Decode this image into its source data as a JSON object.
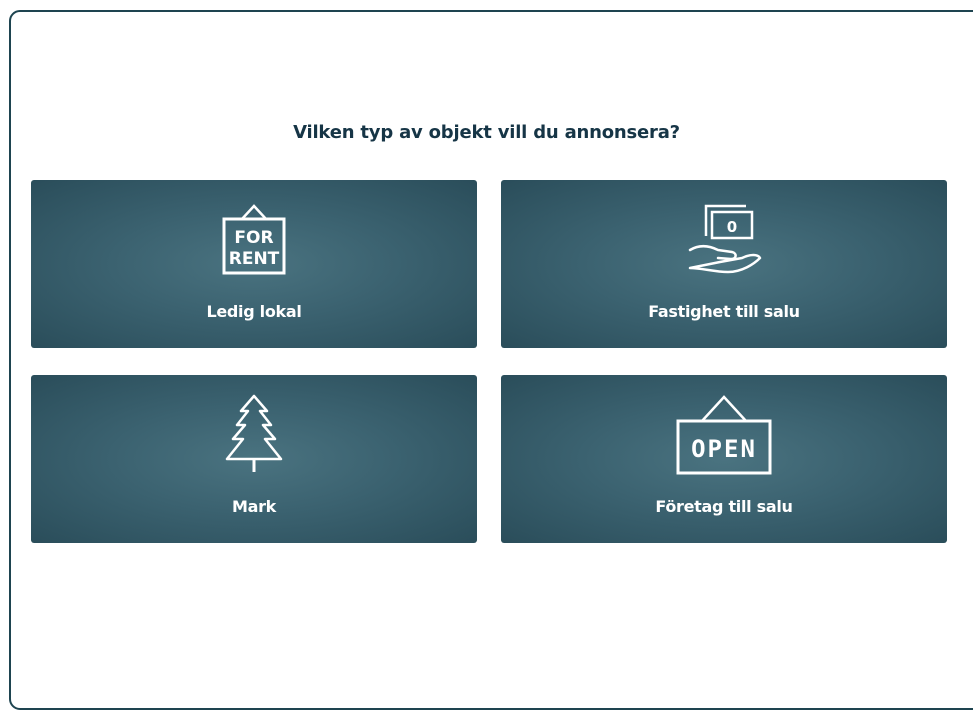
{
  "page": {
    "question": "Vilken typ av objekt vill du annonsera?"
  },
  "cards": [
    {
      "label": "Ledig lokal",
      "icon": "for-rent-sign-icon",
      "icon_text_line1": "FOR",
      "icon_text_line2": "RENT"
    },
    {
      "label": "Fastighet till salu",
      "icon": "money-in-hand-icon",
      "icon_text": "0"
    },
    {
      "label": "Mark",
      "icon": "tree-icon"
    },
    {
      "label": "Företag till salu",
      "icon": "open-sign-icon",
      "icon_text": "OPEN"
    }
  ],
  "colors": {
    "card_background": "#3b6270",
    "card_text": "#ffffff",
    "heading_text": "#163546",
    "frame_border": "#1e4450"
  }
}
